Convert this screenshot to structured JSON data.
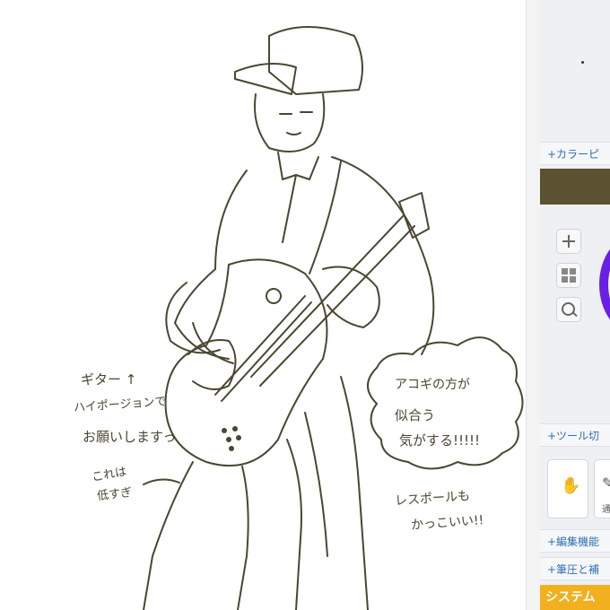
{
  "canvas": {
    "background": "#ffffff",
    "ink_color": "#4b4631",
    "annotations": {
      "guitar_note_1": "ギター ↑",
      "guitar_note_2": "ハイポージョンで",
      "guitar_note_3": "お願いしますっ",
      "small_note_1": "これは",
      "small_note_2": "低すぎ",
      "acoustic_note_1": "アコギの方が",
      "acoustic_note_2": "似合う",
      "acoustic_note_3": "気がする!!!!!",
      "lespaul_note_1": "レスポールも",
      "lespaul_note_2": "かっこいい!!"
    }
  },
  "panel": {
    "color_picker_label": "+カラーピ",
    "selected_color": "#5a5230",
    "tool_switch_label": "+ツール切",
    "edit_label": "+編集機能",
    "pressure_label": "+筆圧と補",
    "system_label": "システム",
    "tool_card_label": "通",
    "icons": [
      "add-layer-icon",
      "grid-icon",
      "zoom-icon",
      "hand-icon",
      "pen-icon"
    ]
  }
}
